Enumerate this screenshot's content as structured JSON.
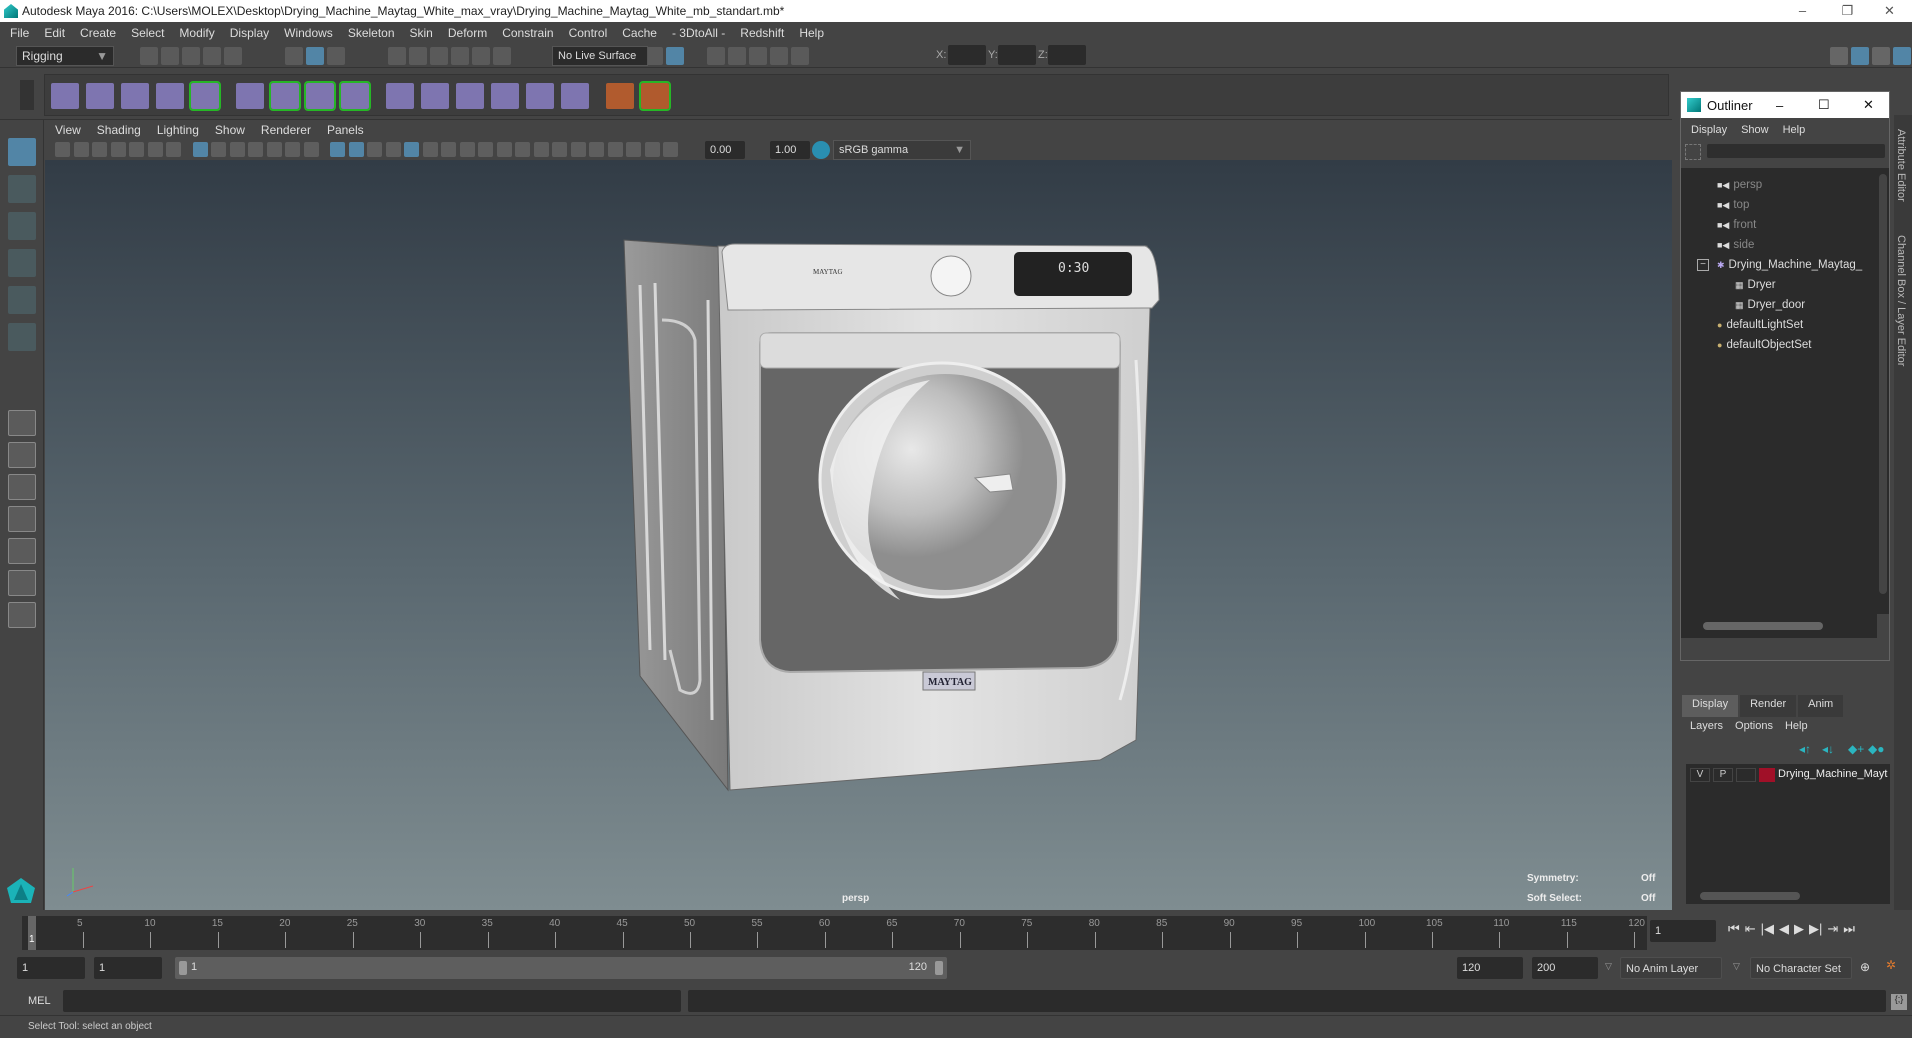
{
  "window": {
    "title": "Autodesk Maya 2016: C:\\Users\\MOLEX\\Desktop\\Drying_Machine_Maytag_White_max_vray\\Drying_Machine_Maytag_White_mb_standart.mb*",
    "minimize": "–",
    "restore": "❐",
    "close": "✕"
  },
  "menu": [
    "File",
    "Edit",
    "Create",
    "Select",
    "Modify",
    "Display",
    "Windows",
    "Skeleton",
    "Skin",
    "Deform",
    "Constrain",
    "Control",
    "Cache",
    "- 3DtoAll -",
    "Redshift",
    "Help"
  ],
  "status": {
    "mode": "Rigging",
    "live_surface": "No Live Surface",
    "x_label": "X:",
    "y_label": "Y:",
    "z_label": "Z:",
    "x": "",
    "y": "",
    "z": ""
  },
  "status_icons": [
    "new-scene-icon",
    "open-scene-icon",
    "save-scene-icon",
    "undo-icon",
    "redo-icon",
    "select-hierarchy-icon",
    "select-object-icon",
    "select-component-icon",
    "snap-grid-icon",
    "snap-curve-icon",
    "snap-point-icon",
    "snap-view-icon",
    "snap-surface-icon",
    "snap-live-icon",
    "input-ops-icon",
    "output-ops-icon",
    "construction-history-icon",
    "render-frame-icon",
    "render-icon",
    "ipr-render-icon",
    "render-settings-icon",
    "hypershade-icon"
  ],
  "shelf_icons": [
    "joint-tool-icon",
    "ik-handle-icon",
    "ik-spline-icon",
    "insert-joint-icon",
    "quick-rig-icon",
    "paint-skin-weights-icon",
    "bind-skin-icon",
    "smooth-bind-icon",
    "interactive-bind-icon",
    "parent-constraint-icon",
    "point-constraint-icon",
    "orient-constraint-icon",
    "scale-constraint-icon",
    "aim-constraint-icon",
    "pole-vector-icon",
    "hik-icon",
    "hik-skeleton-icon"
  ],
  "panel": {
    "menus": [
      "View",
      "Shading",
      "Lighting",
      "Show",
      "Renderer",
      "Panels"
    ],
    "exposure": "0.00",
    "gamma": "1.00",
    "colorspace": "sRGB gamma",
    "camera": "persp"
  },
  "hud": {
    "symmetry_label": "Symmetry:",
    "symmetry": "Off",
    "soft_label": "Soft Select:",
    "soft": "Off"
  },
  "model": {
    "brand": "MAYTAG",
    "display_time": "0:30"
  },
  "outliner": {
    "title": "Outliner",
    "menus": [
      "Display",
      "Show",
      "Help"
    ],
    "items": [
      {
        "label": "persp",
        "type": "camera"
      },
      {
        "label": "top",
        "type": "camera"
      },
      {
        "label": "front",
        "type": "camera"
      },
      {
        "label": "side",
        "type": "camera"
      },
      {
        "label": "Drying_Machine_Maytag_",
        "type": "group"
      },
      {
        "label": "Dryer",
        "type": "mesh"
      },
      {
        "label": "Dryer_door",
        "type": "mesh"
      },
      {
        "label": "defaultLightSet",
        "type": "set"
      },
      {
        "label": "defaultObjectSet",
        "type": "set"
      }
    ]
  },
  "layers": {
    "tabs": [
      "Display",
      "Render",
      "Anim"
    ],
    "active_tab": "Display",
    "menus": [
      "Layers",
      "Options",
      "Help"
    ],
    "row": {
      "v": "V",
      "p": "P",
      "name": "Drying_Machine_Mayt",
      "color": "#a01028"
    }
  },
  "right_tabs": [
    "Attribute Editor",
    "Channel Box / Layer Editor"
  ],
  "timeline": {
    "ticks": [
      "5",
      "10",
      "15",
      "20",
      "25",
      "30",
      "35",
      "40",
      "45",
      "50",
      "55",
      "60",
      "65",
      "70",
      "75",
      "80",
      "85",
      "90",
      "95",
      "100",
      "105",
      "110",
      "115",
      "120"
    ],
    "current": "1",
    "current_field": "1"
  },
  "range": {
    "start": "1",
    "playback_start": "1",
    "slider_start": "1",
    "slider_end": "120",
    "playback_end": "120",
    "end": "200",
    "anim_layer": "No Anim Layer",
    "character_set": "No Character Set"
  },
  "mel": {
    "label": "MEL",
    "input": ""
  },
  "help": "Select Tool: select an object",
  "colors": {
    "accent": "#5285a6",
    "teal": "#2bb5c0",
    "highlight_green": "#22cc22"
  }
}
